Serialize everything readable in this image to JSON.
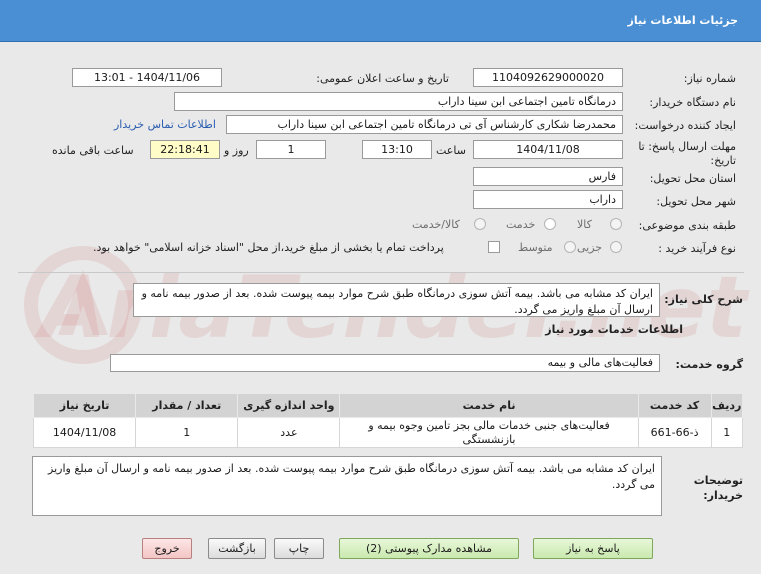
{
  "header": {
    "title": "جزئیات اطلاعات نیاز"
  },
  "fields": {
    "need_number_label": "شماره نیاز:",
    "need_number": "1104092629000020",
    "announce_label": "تاریخ و ساعت اعلان عمومی:",
    "announce_value": "1404/11/06 - 13:01",
    "buyer_org_label": "نام دستگاه خریدار:",
    "buyer_org": "درمانگاه تامین اجتماعی ابن سینا داراب",
    "creator_label": "ایجاد کننده درخواست:",
    "creator": "محمدرضا شکاری کارشناس آی تی درمانگاه تامین اجتماعی ابن سینا داراب",
    "contact_link": "اطلاعات تماس خریدار",
    "deadline_label_1": "مهلت ارسال پاسخ: تا",
    "deadline_label_2": "تاریخ:",
    "deadline_date": "1404/11/08",
    "time_label": "ساعت",
    "deadline_time": "13:10",
    "days_value": "1",
    "days_label": "روز و",
    "remaining_time": "22:18:41",
    "remaining_label": "ساعت باقی مانده",
    "province_label": "استان محل تحویل:",
    "province": "فارس",
    "city_label": "شهر محل تحویل:",
    "city": "داراب",
    "category_label": "طبقه بندی موضوعی:",
    "category_options": [
      "کالا",
      "خدمت",
      "کالا/خدمت"
    ],
    "category_selected": "خدمت",
    "process_label": "نوع فرآیند خرید :",
    "process_options": [
      "جزیی",
      "متوسط"
    ],
    "payment_note": "پرداخت تمام یا بخشی از مبلغ خرید،از محل \"اسناد خزانه اسلامی\" خواهد بود."
  },
  "summary": {
    "label": "شرح کلی نیاز:",
    "text": "ایران کد مشابه می باشد. بیمه آتش سوزی درمانگاه طبق شرح موارد بیمه پیوست شده. بعد از صدور بیمه نامه و ارسال آن مبلغ واریز می گردد."
  },
  "services": {
    "section_title": "اطلاعات خدمات مورد نیاز",
    "group_label": "گروه خدمت:",
    "group_value": "فعالیت‌های مالی و بیمه",
    "columns": [
      "ردیف",
      "کد خدمت",
      "نام خدمت",
      "واحد اندازه گیری",
      "تعداد / مقدار",
      "تاریخ نیاز"
    ],
    "rows": [
      {
        "row": "1",
        "code": "ذ-66-661",
        "name": "فعالیت‌های جنبی خدمات مالی بجز تامین وجوه بیمه و بازنشستگی",
        "unit": "عدد",
        "qty": "1",
        "date": "1404/11/08"
      }
    ]
  },
  "buyer_notes": {
    "label_1": "توضیحات",
    "label_2": "خریدار:",
    "text": "ایران کد مشابه می باشد. بیمه آتش سوزی درمانگاه طبق شرح موارد بیمه پیوست شده. بعد از صدور بیمه نامه و ارسال آن مبلغ واریز می گردد."
  },
  "buttons": {
    "respond": "پاسخ به نیاز",
    "view_docs": "مشاهده مدارک پیوستی (2)",
    "print": "چاپ",
    "back": "بازگشت",
    "exit": "خروج"
  },
  "watermark": {
    "text": "AriaTender.net"
  },
  "colors": {
    "header_bg": "#4a8fd4",
    "link": "#2a5db0",
    "remaining_bg": "#fffcc8"
  }
}
